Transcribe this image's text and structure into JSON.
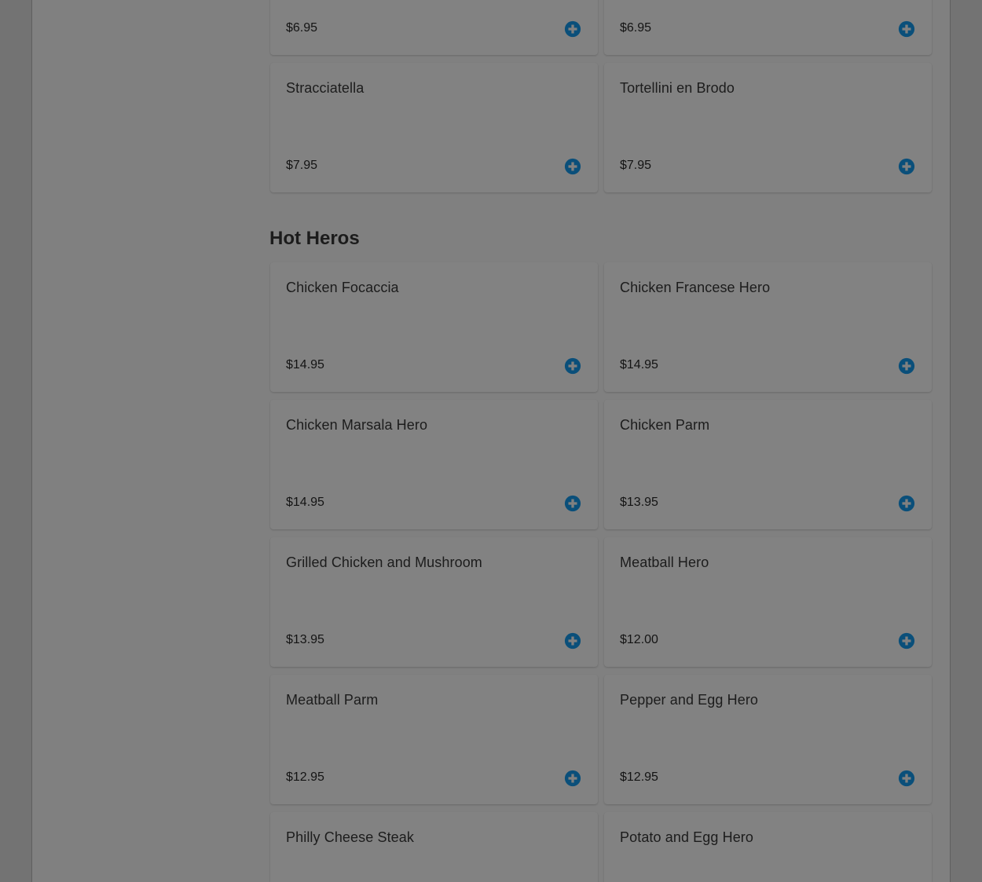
{
  "colors": {
    "accent": "#0a4f7a",
    "overlay": "#808080",
    "text": "#1c1c1c"
  },
  "top_partial": [
    {
      "price": "$6.95",
      "add_icon": "plus-circle-icon"
    },
    {
      "price": "$6.95",
      "add_icon": "plus-circle-icon"
    }
  ],
  "soups": [
    {
      "name": "Stracciatella",
      "price": "$7.95"
    },
    {
      "name": "Tortellini en Brodo",
      "price": "$7.95"
    }
  ],
  "hot_heros": {
    "title": "Hot Heros",
    "items": [
      {
        "name": "Chicken Focaccia",
        "price": "$14.95"
      },
      {
        "name": "Chicken Francese Hero",
        "price": "$14.95"
      },
      {
        "name": "Chicken Marsala Hero",
        "price": "$14.95"
      },
      {
        "name": "Chicken Parm",
        "price": "$13.95"
      },
      {
        "name": "Grilled Chicken and Mushroom",
        "price": "$13.95"
      },
      {
        "name": "Meatball Hero",
        "price": "$12.00"
      },
      {
        "name": "Meatball Parm",
        "price": "$12.95"
      },
      {
        "name": "Pepper and Egg Hero",
        "price": "$12.95"
      },
      {
        "name": "Philly Cheese Steak",
        "price": ""
      },
      {
        "name": "Potato and Egg Hero",
        "price": ""
      }
    ]
  }
}
